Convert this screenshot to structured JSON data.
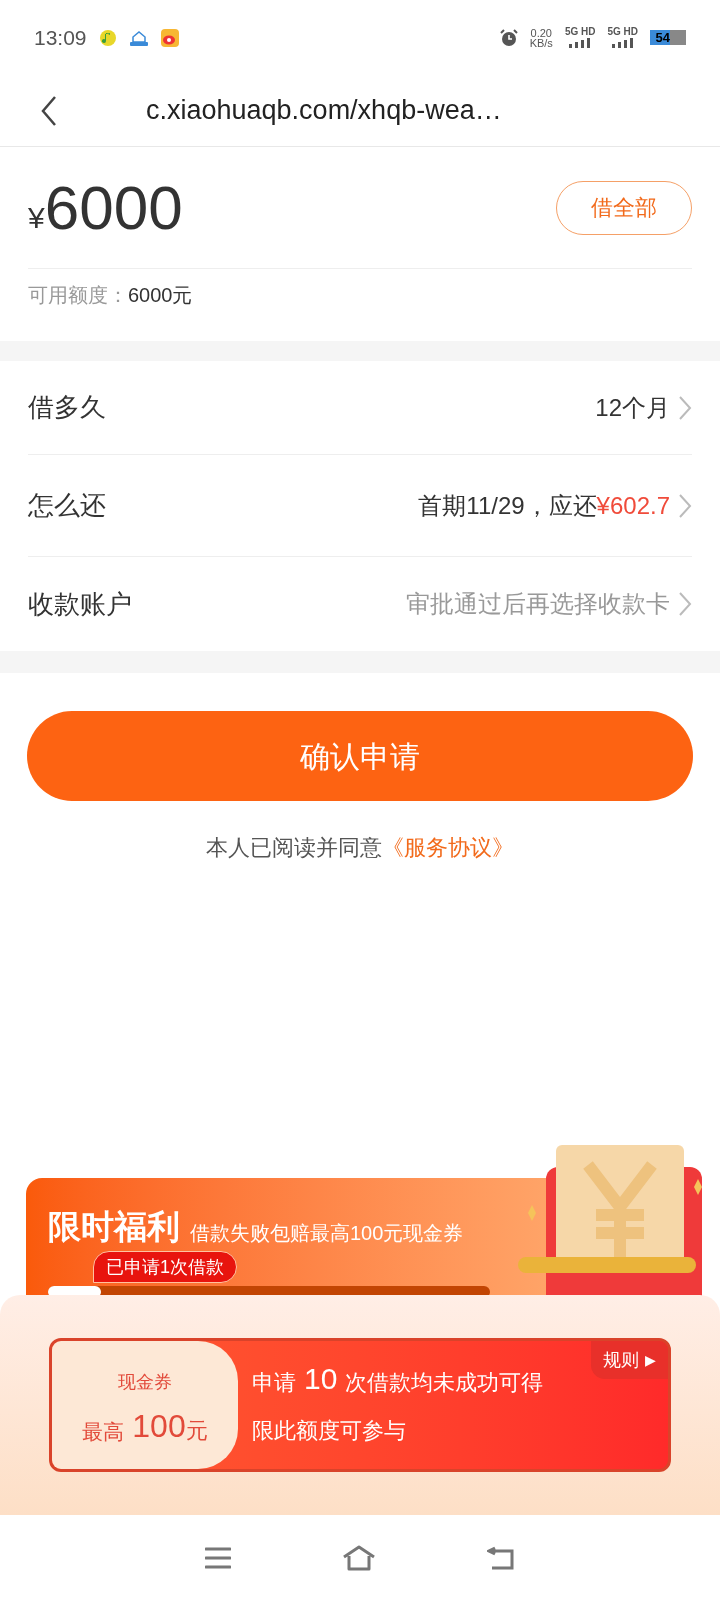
{
  "status_bar": {
    "time": "13:09",
    "speed_value": "0.20",
    "speed_unit": "KB/s",
    "networks": [
      "5G HD",
      "5G HD"
    ],
    "battery": "54"
  },
  "browser": {
    "url": "c.xiaohuaqb.com/xhqb-wea…"
  },
  "amount": {
    "currency": "¥",
    "value": "6000",
    "button": "借全部",
    "available_label": "可用额度：",
    "available_value": "6000元"
  },
  "rows": [
    {
      "label": "借多久",
      "value": "12个月",
      "highlight": "",
      "muted": false
    },
    {
      "label": "怎么还",
      "value": "首期11/29，应还",
      "highlight": "¥602.7",
      "muted": false
    },
    {
      "label": "收款账户",
      "value": "审批通过后再选择收款卡",
      "highlight": "",
      "muted": true
    }
  ],
  "confirm_button": "确认申请",
  "agreement": {
    "text": "本人已阅读并同意",
    "link": "《服务协议》"
  },
  "promo": {
    "title": "限时福利",
    "subtitle": "借款失败包赔最高100元现金券",
    "badge": "已申请1次借款",
    "level": 0.12,
    "coupon": {
      "label": "现金券",
      "max_label": "最高",
      "amount": "100",
      "unit": "元"
    },
    "condition": [
      "申请",
      "10",
      "次借款均未成功可得"
    ],
    "note": "限此额度可参与",
    "rules": {
      "label": "规则",
      "arrow": "▶"
    }
  }
}
